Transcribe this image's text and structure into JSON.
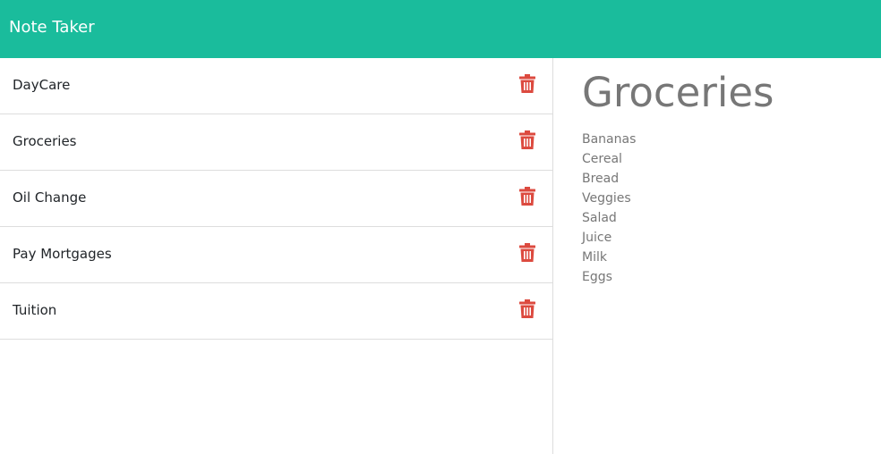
{
  "app": {
    "brand": "Note Taker",
    "accent_color": "#1abc9c",
    "delete_color": "#dc4a3f"
  },
  "notes": [
    {
      "title": "DayCare",
      "icon": "trash-icon"
    },
    {
      "title": "Groceries",
      "icon": "trash-icon"
    },
    {
      "title": "Oil Change",
      "icon": "trash-icon"
    },
    {
      "title": "Pay Mortgages",
      "icon": "trash-icon"
    },
    {
      "title": "Tuition",
      "icon": "trash-icon"
    }
  ],
  "active_note": {
    "title": "Groceries",
    "lines": [
      "Bananas",
      "Cereal",
      "Bread",
      "Veggies",
      "Salad",
      "Juice",
      "Milk",
      "Eggs"
    ]
  }
}
